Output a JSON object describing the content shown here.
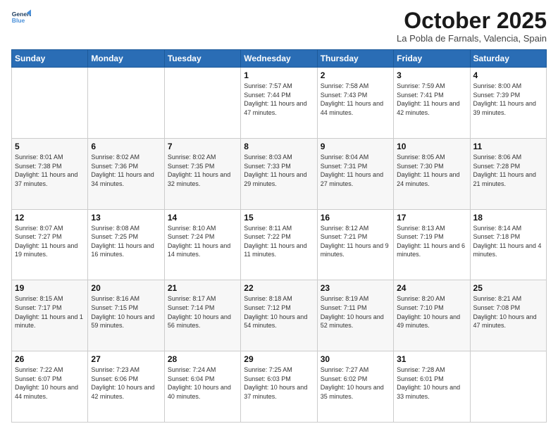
{
  "header": {
    "logo_line1": "General",
    "logo_line2": "Blue",
    "month_title": "October 2025",
    "location": "La Pobla de Farnals, Valencia, Spain"
  },
  "days_of_week": [
    "Sunday",
    "Monday",
    "Tuesday",
    "Wednesday",
    "Thursday",
    "Friday",
    "Saturday"
  ],
  "weeks": [
    [
      {
        "day": "",
        "sunrise": "",
        "sunset": "",
        "daylight": ""
      },
      {
        "day": "",
        "sunrise": "",
        "sunset": "",
        "daylight": ""
      },
      {
        "day": "",
        "sunrise": "",
        "sunset": "",
        "daylight": ""
      },
      {
        "day": "1",
        "sunrise": "Sunrise: 7:57 AM",
        "sunset": "Sunset: 7:44 PM",
        "daylight": "Daylight: 11 hours and 47 minutes."
      },
      {
        "day": "2",
        "sunrise": "Sunrise: 7:58 AM",
        "sunset": "Sunset: 7:43 PM",
        "daylight": "Daylight: 11 hours and 44 minutes."
      },
      {
        "day": "3",
        "sunrise": "Sunrise: 7:59 AM",
        "sunset": "Sunset: 7:41 PM",
        "daylight": "Daylight: 11 hours and 42 minutes."
      },
      {
        "day": "4",
        "sunrise": "Sunrise: 8:00 AM",
        "sunset": "Sunset: 7:39 PM",
        "daylight": "Daylight: 11 hours and 39 minutes."
      }
    ],
    [
      {
        "day": "5",
        "sunrise": "Sunrise: 8:01 AM",
        "sunset": "Sunset: 7:38 PM",
        "daylight": "Daylight: 11 hours and 37 minutes."
      },
      {
        "day": "6",
        "sunrise": "Sunrise: 8:02 AM",
        "sunset": "Sunset: 7:36 PM",
        "daylight": "Daylight: 11 hours and 34 minutes."
      },
      {
        "day": "7",
        "sunrise": "Sunrise: 8:02 AM",
        "sunset": "Sunset: 7:35 PM",
        "daylight": "Daylight: 11 hours and 32 minutes."
      },
      {
        "day": "8",
        "sunrise": "Sunrise: 8:03 AM",
        "sunset": "Sunset: 7:33 PM",
        "daylight": "Daylight: 11 hours and 29 minutes."
      },
      {
        "day": "9",
        "sunrise": "Sunrise: 8:04 AM",
        "sunset": "Sunset: 7:31 PM",
        "daylight": "Daylight: 11 hours and 27 minutes."
      },
      {
        "day": "10",
        "sunrise": "Sunrise: 8:05 AM",
        "sunset": "Sunset: 7:30 PM",
        "daylight": "Daylight: 11 hours and 24 minutes."
      },
      {
        "day": "11",
        "sunrise": "Sunrise: 8:06 AM",
        "sunset": "Sunset: 7:28 PM",
        "daylight": "Daylight: 11 hours and 21 minutes."
      }
    ],
    [
      {
        "day": "12",
        "sunrise": "Sunrise: 8:07 AM",
        "sunset": "Sunset: 7:27 PM",
        "daylight": "Daylight: 11 hours and 19 minutes."
      },
      {
        "day": "13",
        "sunrise": "Sunrise: 8:08 AM",
        "sunset": "Sunset: 7:25 PM",
        "daylight": "Daylight: 11 hours and 16 minutes."
      },
      {
        "day": "14",
        "sunrise": "Sunrise: 8:10 AM",
        "sunset": "Sunset: 7:24 PM",
        "daylight": "Daylight: 11 hours and 14 minutes."
      },
      {
        "day": "15",
        "sunrise": "Sunrise: 8:11 AM",
        "sunset": "Sunset: 7:22 PM",
        "daylight": "Daylight: 11 hours and 11 minutes."
      },
      {
        "day": "16",
        "sunrise": "Sunrise: 8:12 AM",
        "sunset": "Sunset: 7:21 PM",
        "daylight": "Daylight: 11 hours and 9 minutes."
      },
      {
        "day": "17",
        "sunrise": "Sunrise: 8:13 AM",
        "sunset": "Sunset: 7:19 PM",
        "daylight": "Daylight: 11 hours and 6 minutes."
      },
      {
        "day": "18",
        "sunrise": "Sunrise: 8:14 AM",
        "sunset": "Sunset: 7:18 PM",
        "daylight": "Daylight: 11 hours and 4 minutes."
      }
    ],
    [
      {
        "day": "19",
        "sunrise": "Sunrise: 8:15 AM",
        "sunset": "Sunset: 7:17 PM",
        "daylight": "Daylight: 11 hours and 1 minute."
      },
      {
        "day": "20",
        "sunrise": "Sunrise: 8:16 AM",
        "sunset": "Sunset: 7:15 PM",
        "daylight": "Daylight: 10 hours and 59 minutes."
      },
      {
        "day": "21",
        "sunrise": "Sunrise: 8:17 AM",
        "sunset": "Sunset: 7:14 PM",
        "daylight": "Daylight: 10 hours and 56 minutes."
      },
      {
        "day": "22",
        "sunrise": "Sunrise: 8:18 AM",
        "sunset": "Sunset: 7:12 PM",
        "daylight": "Daylight: 10 hours and 54 minutes."
      },
      {
        "day": "23",
        "sunrise": "Sunrise: 8:19 AM",
        "sunset": "Sunset: 7:11 PM",
        "daylight": "Daylight: 10 hours and 52 minutes."
      },
      {
        "day": "24",
        "sunrise": "Sunrise: 8:20 AM",
        "sunset": "Sunset: 7:10 PM",
        "daylight": "Daylight: 10 hours and 49 minutes."
      },
      {
        "day": "25",
        "sunrise": "Sunrise: 8:21 AM",
        "sunset": "Sunset: 7:08 PM",
        "daylight": "Daylight: 10 hours and 47 minutes."
      }
    ],
    [
      {
        "day": "26",
        "sunrise": "Sunrise: 7:22 AM",
        "sunset": "Sunset: 6:07 PM",
        "daylight": "Daylight: 10 hours and 44 minutes."
      },
      {
        "day": "27",
        "sunrise": "Sunrise: 7:23 AM",
        "sunset": "Sunset: 6:06 PM",
        "daylight": "Daylight: 10 hours and 42 minutes."
      },
      {
        "day": "28",
        "sunrise": "Sunrise: 7:24 AM",
        "sunset": "Sunset: 6:04 PM",
        "daylight": "Daylight: 10 hours and 40 minutes."
      },
      {
        "day": "29",
        "sunrise": "Sunrise: 7:25 AM",
        "sunset": "Sunset: 6:03 PM",
        "daylight": "Daylight: 10 hours and 37 minutes."
      },
      {
        "day": "30",
        "sunrise": "Sunrise: 7:27 AM",
        "sunset": "Sunset: 6:02 PM",
        "daylight": "Daylight: 10 hours and 35 minutes."
      },
      {
        "day": "31",
        "sunrise": "Sunrise: 7:28 AM",
        "sunset": "Sunset: 6:01 PM",
        "daylight": "Daylight: 10 hours and 33 minutes."
      },
      {
        "day": "",
        "sunrise": "",
        "sunset": "",
        "daylight": ""
      }
    ]
  ]
}
